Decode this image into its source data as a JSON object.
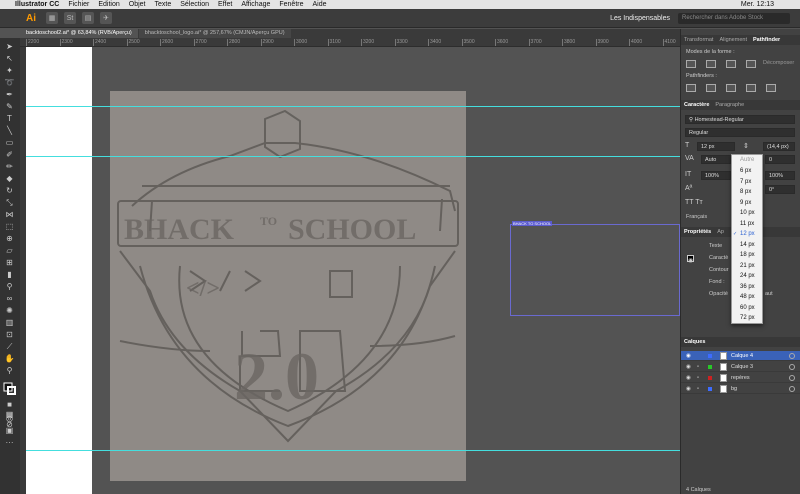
{
  "menubar": {
    "apple": "",
    "app": "Illustrator CC",
    "menus": [
      "Fichier",
      "Edition",
      "Objet",
      "Texte",
      "Sélection",
      "Effet",
      "Affichage",
      "Fenêtre",
      "Aide"
    ],
    "clock": "Mer. 12:13"
  },
  "apptoolbar": {
    "logo": "Ai",
    "workspace": "Les Indispensables",
    "search_placeholder": "Rechercher dans Adobe Stock"
  },
  "doc_tabs": [
    {
      "label": "backtoschool2.ai* @ 63,84% (RVB/Aperçu)",
      "active": true
    },
    {
      "label": "bhacktoschool_logo.ai* @ 257,67% (CMJN/Aperçu GPU)",
      "active": false
    }
  ],
  "ruler": {
    "ticks": [
      "2200",
      "2300",
      "2400",
      "2500",
      "2600",
      "2700",
      "2800",
      "2900",
      "3000",
      "3100",
      "3200",
      "3300",
      "3400",
      "3500",
      "3600",
      "3700",
      "3800",
      "3900",
      "4000",
      "4100"
    ]
  },
  "canvas": {
    "selection_label": "BHACK TO SCHOOL",
    "sketch": {
      "banner_left": "BHACK",
      "banner_to": "TO",
      "banner_right": "SCHOOL",
      "code_symbol": "</>",
      "version": "2.0"
    }
  },
  "right_panel": {
    "top_tabs": [
      "Transformat",
      "Alignement",
      "Pathfinder"
    ],
    "mode_label": "Modes de la forme :",
    "decomposer": "Décomposer",
    "pathfinders_label": "Pathfinders :",
    "char_tabs": [
      "Caractère",
      "Paragraphe"
    ],
    "font_family": "Homestead-Regular",
    "font_style": "Regular",
    "font_size": "12 px",
    "leading": "(14,4 px)",
    "kerning": "Auto",
    "scale": "100%",
    "scale_v": "100%",
    "lang": "Français",
    "size_options": {
      "header": "Autre",
      "items": [
        "6 px",
        "7 px",
        "8 px",
        "9 px",
        "10 px",
        "11 px",
        "12 px",
        "14 px",
        "18 px",
        "21 px",
        "24 px",
        "36 px",
        "48 px",
        "60 px",
        "72 px"
      ],
      "selected": "12 px"
    },
    "props_tabs": [
      "Propriétés",
      "Ap"
    ],
    "props_rows": [
      "Texte",
      "Caractè",
      "Contour",
      "Fond :",
      "Opacité"
    ],
    "props_suffix": "aut",
    "layers_tab": "Calques",
    "layers": [
      {
        "name": "Calque 4",
        "color": "#3d6cff",
        "active": true
      },
      {
        "name": "Calque 3",
        "color": "#28c828",
        "active": false
      },
      {
        "name": "repères",
        "color": "#cc2222",
        "active": false
      },
      {
        "name": "bg",
        "color": "#3d6cff",
        "active": false
      }
    ],
    "layers_count": "4 Calques"
  }
}
